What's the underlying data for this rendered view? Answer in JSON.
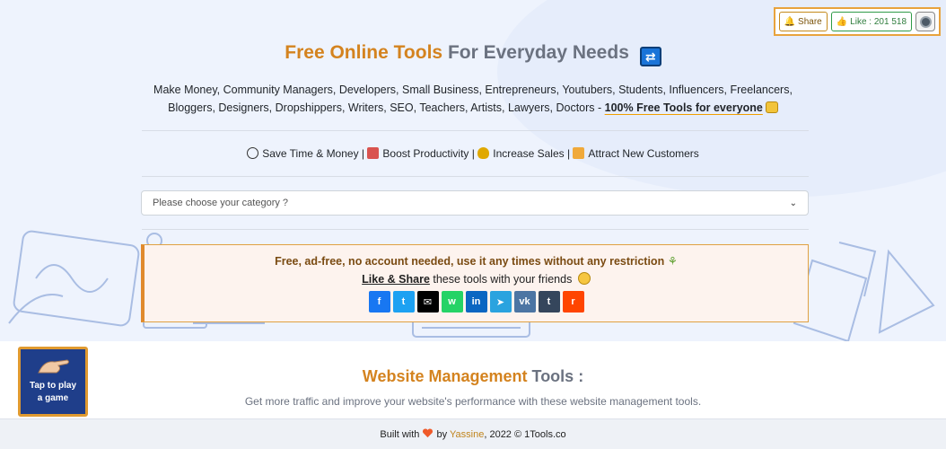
{
  "topbar": {
    "share_label": "Share",
    "like_label": "Like : 201 518"
  },
  "hero": {
    "title_part1": "Free Online Tools",
    "title_part2": "For Everyday Needs",
    "audience_text": "Make Money, Community Managers, Developers, Small Business, Entrepreneurs, Youtubers, Students, Influencers, Freelancers, Bloggers, Designers, Dropshippers, Writers, SEO, Teachers, Artists, Lawyers, Doctors - ",
    "free_link": "100% Free Tools for everyone"
  },
  "benefits": [
    {
      "icon": "clock-icon",
      "label": "Save Time & Money",
      "color": "#333333"
    },
    {
      "icon": "toolbox-icon",
      "label": "Boost Productivity",
      "color": "#d9534f"
    },
    {
      "icon": "money-bag-icon",
      "label": "Increase Sales",
      "color": "#e0a800"
    },
    {
      "icon": "handshake-icon",
      "label": "Attract New Customers",
      "color": "#f0a93a"
    }
  ],
  "category_select": {
    "placeholder": "Please choose your category ?"
  },
  "infobox": {
    "line1": "Free, ad-free, no account needed, use it any times without any restriction",
    "like_share": "Like & Share",
    "line2_rest": " these tools with your friends"
  },
  "social_buttons": [
    {
      "name": "facebook",
      "glyph": "f",
      "color": "#1877f2"
    },
    {
      "name": "twitter",
      "glyph": "t",
      "color": "#1da1f2"
    },
    {
      "name": "email",
      "glyph": "✉",
      "color": "#000000"
    },
    {
      "name": "whatsapp",
      "glyph": "w",
      "color": "#25d366"
    },
    {
      "name": "linkedin",
      "glyph": "in",
      "color": "#0a66c2"
    },
    {
      "name": "telegram",
      "glyph": "➤",
      "color": "#2aa3df"
    },
    {
      "name": "vk",
      "glyph": "vk",
      "color": "#4c75a3"
    },
    {
      "name": "tumblr",
      "glyph": "t",
      "color": "#35465c"
    },
    {
      "name": "reddit",
      "glyph": "r",
      "color": "#ff4500"
    }
  ],
  "section": {
    "title_part1": "Website Management",
    "title_part2": "Tools :",
    "description": "Get more traffic and improve your website's performance with these website management tools."
  },
  "game_widget": {
    "label": "Tap to play a game"
  },
  "footer": {
    "built_with": "Built with",
    "by": "by",
    "author": "Yassine",
    "rest": ", 2022 © 1Tools.co"
  }
}
